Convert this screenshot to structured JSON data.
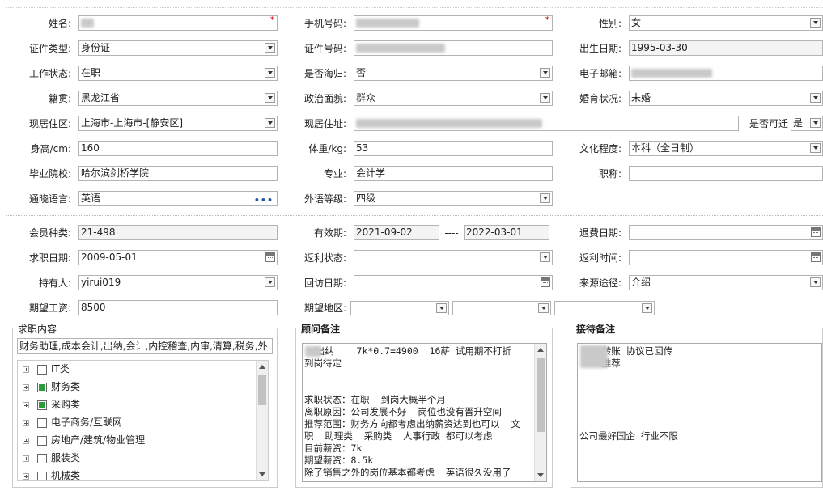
{
  "personal": {
    "name_label": "姓名:",
    "phone_label": "手机号码:",
    "gender_label": "性别:",
    "gender_value": "女",
    "id_type_label": "证件类型:",
    "id_type_value": "身份证",
    "id_no_label": "证件号码:",
    "birth_label": "出生日期:",
    "birth_value": "1995-03-30",
    "work_status_label": "工作状态:",
    "work_status_value": "在职",
    "returnee_label": "是否海归:",
    "returnee_value": "否",
    "email_label": "电子邮箱:",
    "origin_label": "籍贯:",
    "origin_value": "黑龙江省",
    "politics_label": "政治面貌:",
    "politics_value": "群众",
    "marital_label": "婚育状况:",
    "marital_value": "未婚",
    "residence_label": "现居住区:",
    "residence_value": "上海市-上海市-[静安区]",
    "address_label": "现居住址:",
    "relocate_label": "是否可迁",
    "relocate_value": "是",
    "height_label": "身高/cm:",
    "height_value": "160",
    "weight_label": "体重/kg:",
    "weight_value": "53",
    "education_label": "文化程度:",
    "education_value": "本科（全日制）",
    "school_label": "毕业院校:",
    "school_value": "哈尔滨剑桥学院",
    "major_label": "专业:",
    "major_value": "会计学",
    "title_label": "职称:",
    "title_value": "",
    "language_label": "通晓语言:",
    "language_value": "英语",
    "lang_level_label": "外语等级:",
    "lang_level_value": "四级"
  },
  "membership": {
    "member_type_label": "会员种类:",
    "member_type_value": "21-498",
    "validity_label": "有效期:",
    "validity_from": "2021-09-02",
    "validity_sep": "----",
    "validity_to": "2022-03-01",
    "refund_date_label": "退费日期:",
    "apply_date_label": "求职日期:",
    "apply_date_value": "2009-05-01",
    "rebate_status_label": "返利状态:",
    "rebate_time_label": "返利时间:",
    "holder_label": "持有人:",
    "holder_value": "yirui019",
    "visit_date_label": "回访日期:",
    "source_label": "来源途径:",
    "source_value": "介绍",
    "salary_label": "期望工资:",
    "salary_value": "8500",
    "region_label": "期望地区:"
  },
  "job_content": {
    "legend": "求职内容",
    "summary": "财务助理,成本会计,出纳,会计,内控稽查,内审,清算,税务,外",
    "tree": [
      {
        "label": "IT类",
        "checked": false
      },
      {
        "label": "财务类",
        "checked": true
      },
      {
        "label": "采购类",
        "checked": true
      },
      {
        "label": "电子商务/互联网",
        "checked": false
      },
      {
        "label": "房地产/建筑/物业管理",
        "checked": false
      },
      {
        "label": "服装类",
        "checked": false
      },
      {
        "label": "机械类",
        "checked": false
      }
    ]
  },
  "advisor_notes": {
    "legend": "顾问备注",
    "lines": [
      "  出纳    7k*0.7=4900  16薪 试用期不打折",
      "到岗待定",
      "",
      "",
      "求职状态：在职  到岗大概半个月",
      "离职原因：公司发展不好  岗位也没有晋升空间",
      "推荐范围：财务方向都考虑出纳薪资达到也可以  文",
      "职  助理类  采购类  人事行政 都可以考虑",
      "目前薪资：7k",
      "期望薪资：8.5k",
      "除了销售之外的岗位基本都考虑  英语很久没用了"
    ]
  },
  "reception_notes": {
    "legend": "接待备注",
    "lines": [
      "    转账 协议已回传",
      "    推荐",
      "",
      "",
      "",
      "",
      "",
      "公司最好国企 行业不限"
    ]
  },
  "colors": {
    "required": "#dd0000",
    "checked": "#2a9d3a",
    "border": "#b3b3b3"
  }
}
